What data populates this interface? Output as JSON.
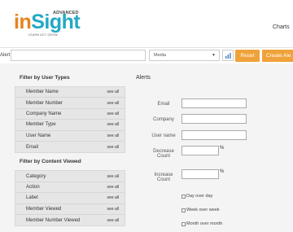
{
  "logo": {
    "advanced": "ADVANCED",
    "brand_in": "in",
    "brand_sight": "Sight",
    "tagline": "LEARN ACT GROW"
  },
  "nav": {
    "charts_label": "Charts"
  },
  "filter_bar": {
    "alert_title_label": "Alert Title",
    "alert_title_value": "",
    "metric_selected": "Media",
    "reset_label": "Reset",
    "create_label": "Create Ale"
  },
  "sidebar": {
    "user_types_title": "Filter by User Types",
    "user_types": [
      {
        "label": "Member Name",
        "see": "see all"
      },
      {
        "label": "Member Number",
        "see": "see all"
      },
      {
        "label": "Company Name",
        "see": "see all"
      },
      {
        "label": "Member Type",
        "see": "see all"
      },
      {
        "label": "User Name",
        "see": "see all"
      },
      {
        "label": "Email",
        "see": "see all"
      }
    ],
    "content_title": "Filter by Content Viewed",
    "content": [
      {
        "label": "Category",
        "see": "see all"
      },
      {
        "label": "Action",
        "see": "see all"
      },
      {
        "label": "Label",
        "see": "see all"
      },
      {
        "label": "Member Viewed",
        "see": "see all"
      },
      {
        "label": "Member Number Viewed",
        "see": "see all"
      }
    ]
  },
  "alerts": {
    "title": "Alerts",
    "email_label": "Email",
    "company_label": "Company",
    "username_label": "User name",
    "decrease_label_1": "Decrease",
    "decrease_label_2": "Count",
    "increase_label_1": "Increase",
    "increase_label_2": "Count",
    "percent_sign": "%",
    "day_over_day": "Day over day",
    "week_over_week": "Week over week",
    "month_over_month": "Month over month"
  }
}
